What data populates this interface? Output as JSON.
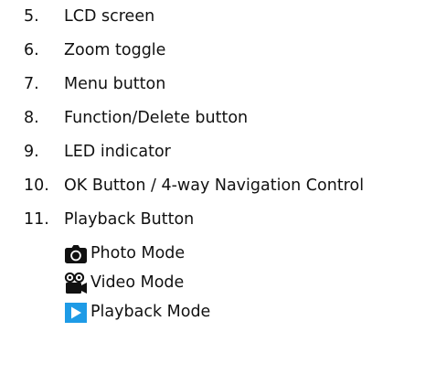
{
  "items": [
    {
      "num": "5.",
      "text": "LCD screen"
    },
    {
      "num": "6.",
      "text": "Zoom toggle"
    },
    {
      "num": "7.",
      "text": "Menu button"
    },
    {
      "num": "8.",
      "text": "Function/Delete button"
    },
    {
      "num": "9.",
      "text": "LED indicator"
    },
    {
      "num": "10.",
      "text": "OK Button / 4-way Navigation Control"
    },
    {
      "num": "11.",
      "text": "Playback Button"
    }
  ],
  "modes": [
    {
      "icon": "camera-icon",
      "label": "Photo Mode"
    },
    {
      "icon": "video-camera-icon",
      "label": "Video Mode"
    },
    {
      "icon": "playback-icon",
      "label": "Playback Mode"
    }
  ],
  "colors": {
    "text": "#111111",
    "icon_dark": "#111111",
    "playback_blue": "#1e9be6"
  }
}
